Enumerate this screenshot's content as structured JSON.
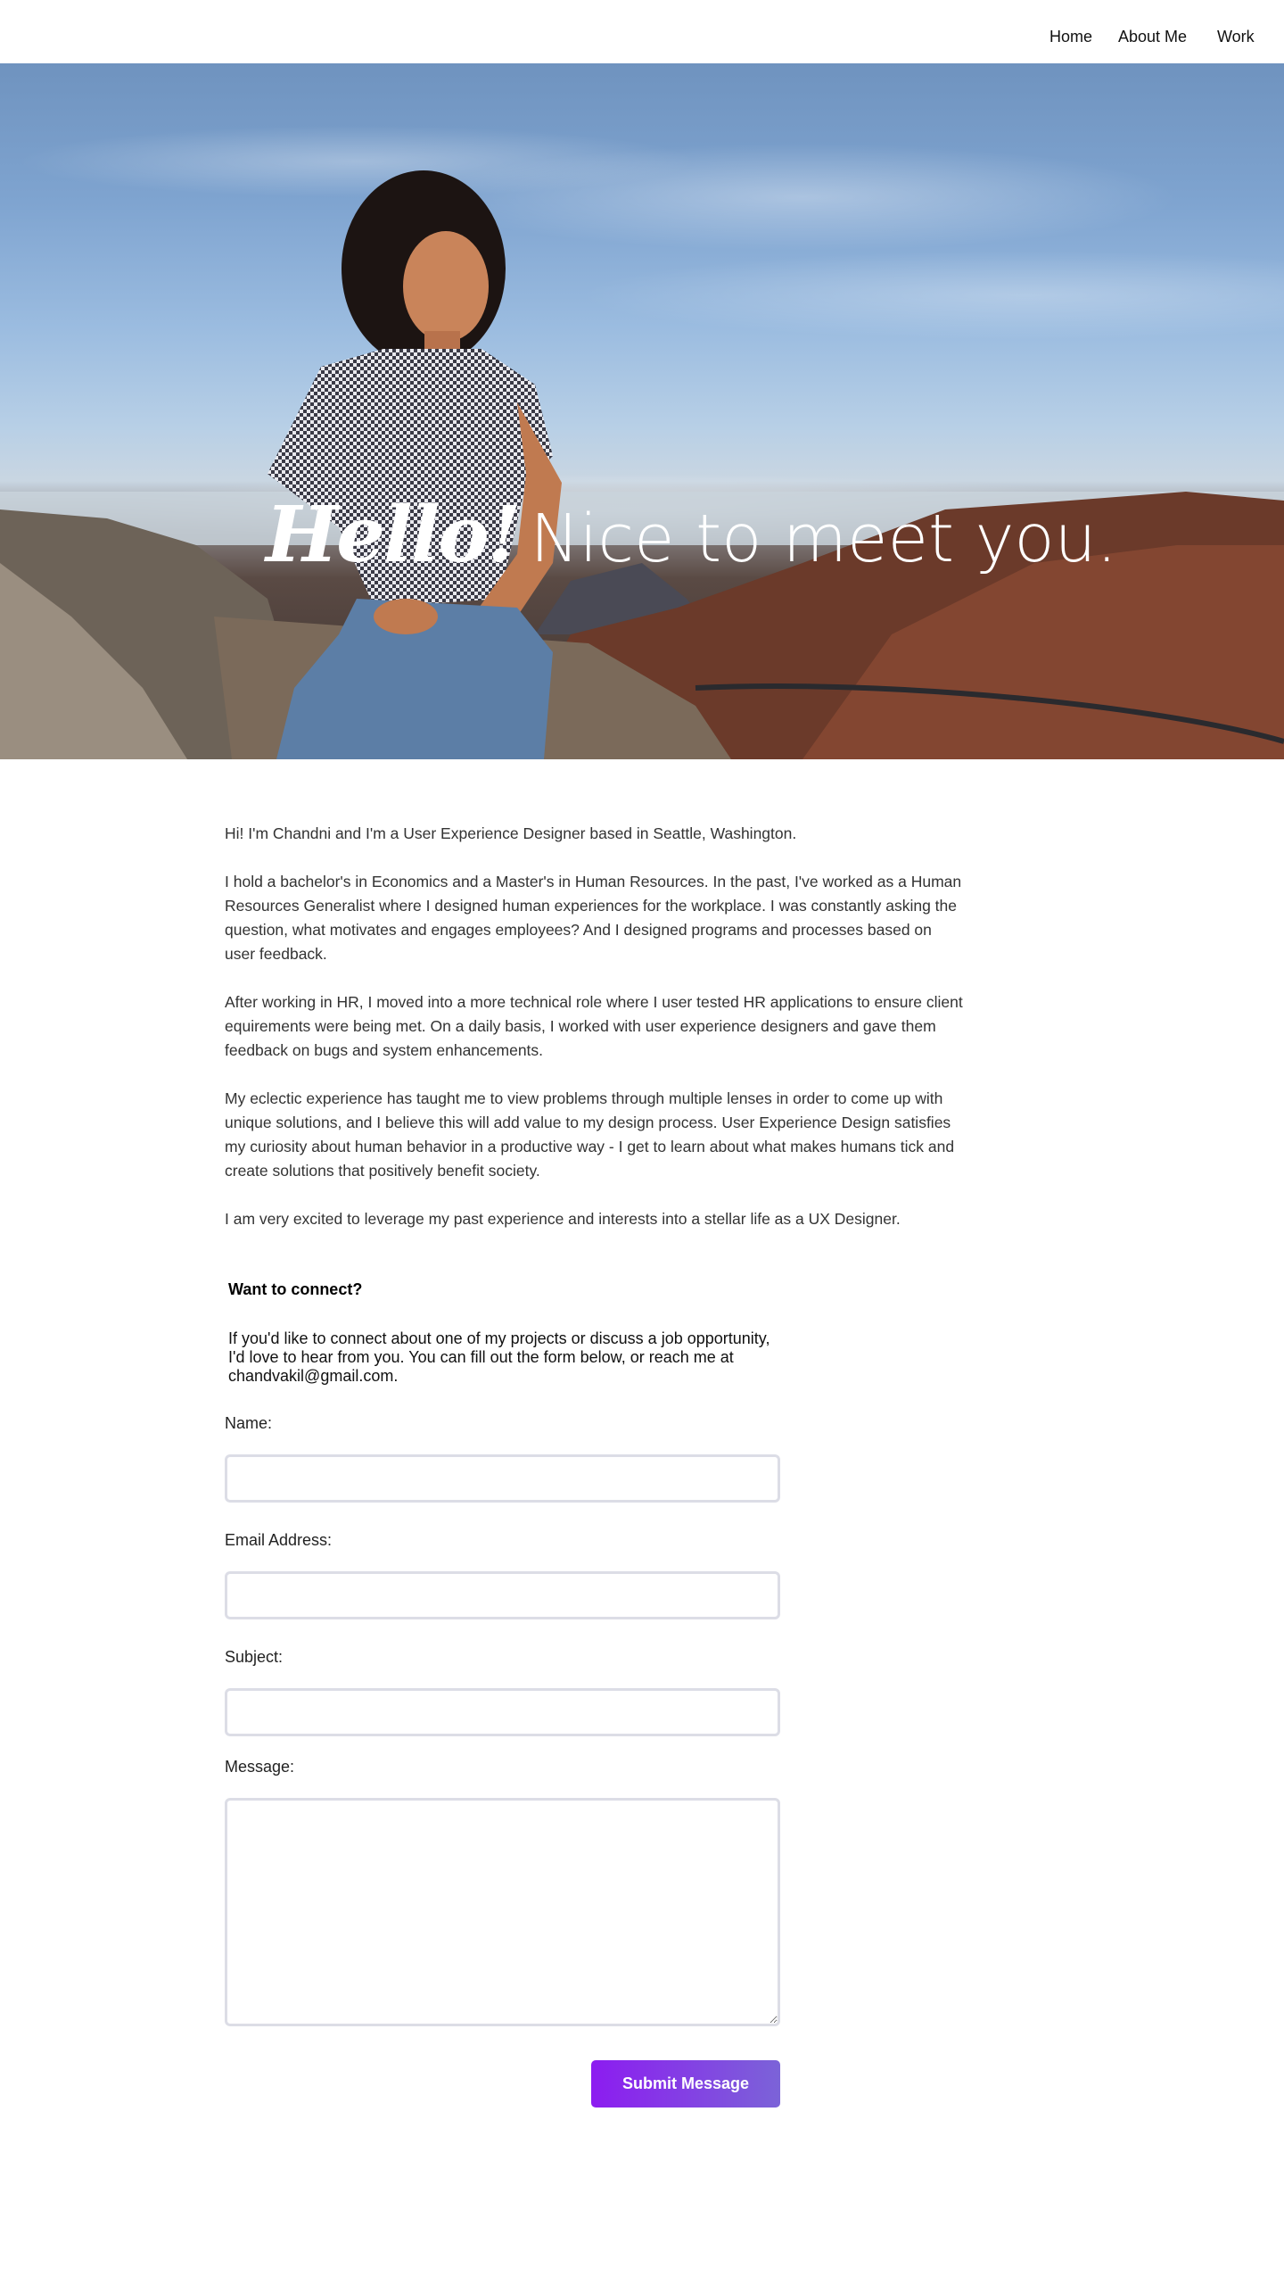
{
  "nav": {
    "items": [
      {
        "label": "Home"
      },
      {
        "label": "About Me"
      },
      {
        "label": "Work"
      }
    ]
  },
  "hero": {
    "greeting": "Hello!",
    "headline": "Nice to meet you."
  },
  "bio": {
    "paragraphs": [
      "Hi! I'm Chandni and I'm a User Experience Designer based in Seattle, Washington.",
      "I hold a bachelor's in Economics and a Master's in Human Resources.  In the past, I've worked as a Human Resources Generalist where I designed human experiences for the workplace. I was constantly asking the question, what motivates and engages employees? And I designed programs and processes based on user feedback.",
      "After working in HR, I moved into a more technical role where I user tested HR applications to ensure client equirements were being met.  On a daily basis, I worked with user experience designers and gave them feedback on bugs and system enhancements.",
      "My eclectic experience has taught me to view problems through multiple lenses in order to come up with unique solutions, and I believe this will add value to my design process.  User Experience Design satisfies my curiosity about human behavior in a productive way - I get to learn about what makes humans tick and create solutions that positively benefit society.",
      "I am very excited to leverage my past experience and interests into a stellar life as a UX Designer."
    ]
  },
  "contact": {
    "title": "Want to connect?",
    "text": "If you'd like to connect about one of my projects or discuss a job opportunity, I'd love to hear from you.  You can fill out the form below, or reach me at chandvakil@gmail.com.",
    "form": {
      "name_label": "Name:",
      "name_value": "",
      "email_label": "Email Address:",
      "email_value": "",
      "subject_label": "Subject:",
      "subject_value": "",
      "message_label": "Message:",
      "message_value": "",
      "submit_label": "Submit Message"
    }
  },
  "colors": {
    "accent_start": "#8c1cf0",
    "accent_end": "#7b63d8",
    "input_border": "#dcdde6"
  }
}
